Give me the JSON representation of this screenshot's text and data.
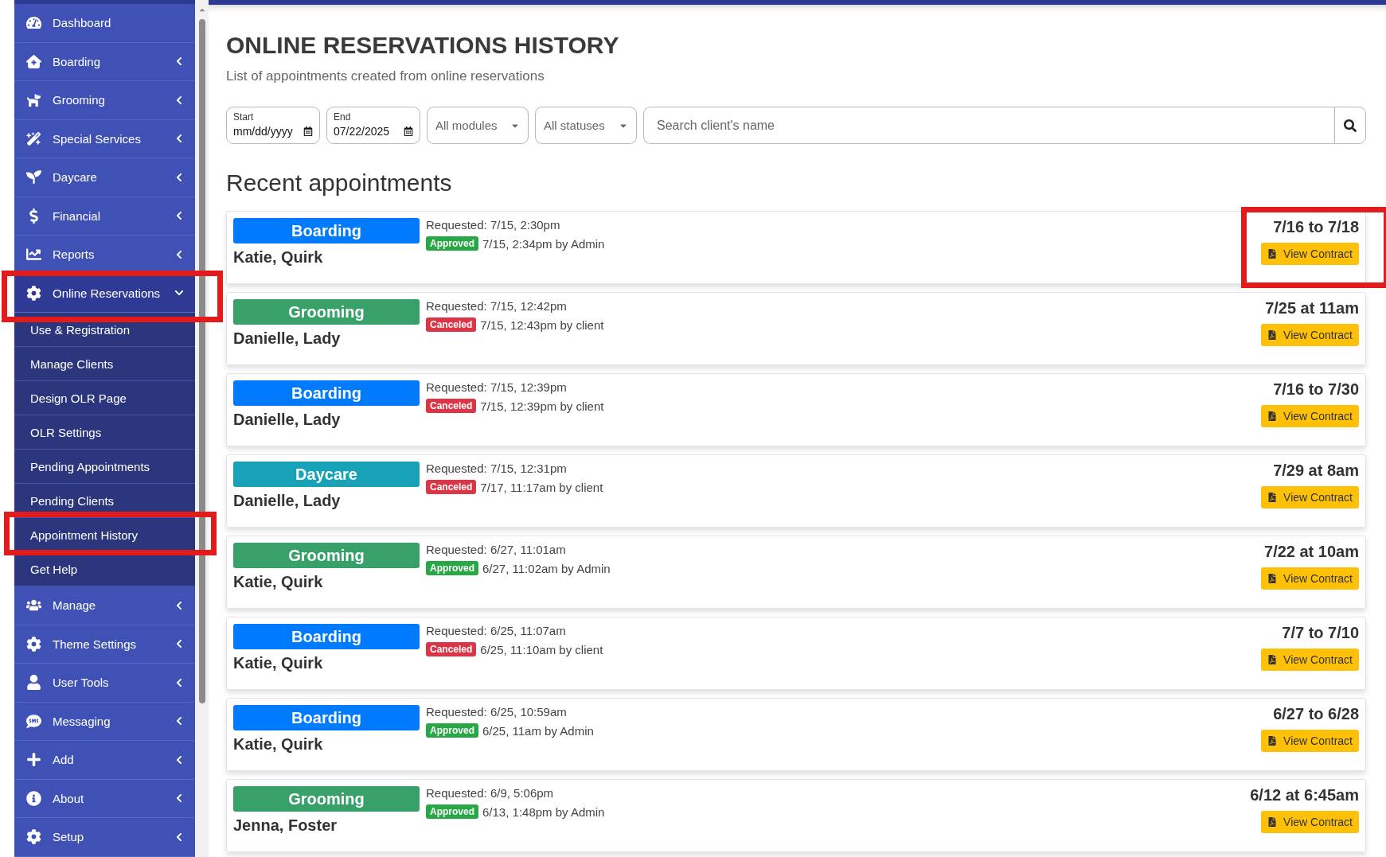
{
  "sidebar": {
    "items": [
      {
        "label": "Dashboard",
        "kind": "link",
        "expanded": false,
        "highlighted": false
      },
      {
        "label": "Boarding",
        "kind": "menu",
        "expanded": false,
        "highlighted": false
      },
      {
        "label": "Grooming",
        "kind": "menu",
        "expanded": false,
        "highlighted": false
      },
      {
        "label": "Special Services",
        "kind": "menu",
        "expanded": false,
        "highlighted": false
      },
      {
        "label": "Daycare",
        "kind": "menu",
        "expanded": false,
        "highlighted": false
      },
      {
        "label": "Financial",
        "kind": "menu",
        "expanded": false,
        "highlighted": false
      },
      {
        "label": "Reports",
        "kind": "menu",
        "expanded": false,
        "highlighted": false
      },
      {
        "label": "Online Reservations",
        "kind": "menu",
        "expanded": true,
        "highlighted": true,
        "children": [
          {
            "label": "Use & Registration",
            "highlighted": false
          },
          {
            "label": "Manage Clients",
            "highlighted": false
          },
          {
            "label": "Design OLR Page",
            "highlighted": false
          },
          {
            "label": "OLR Settings",
            "highlighted": false
          },
          {
            "label": "Pending Appointments",
            "highlighted": false
          },
          {
            "label": "Pending Clients",
            "highlighted": false
          },
          {
            "label": "Appointment History",
            "highlighted": true
          },
          {
            "label": "Get Help",
            "highlighted": false
          }
        ]
      },
      {
        "label": "Manage",
        "kind": "menu",
        "expanded": false,
        "highlighted": false
      },
      {
        "label": "Theme Settings",
        "kind": "menu",
        "expanded": false,
        "highlighted": false
      },
      {
        "label": "User Tools",
        "kind": "menu",
        "expanded": false,
        "highlighted": false
      },
      {
        "label": "Messaging",
        "kind": "menu",
        "expanded": false,
        "highlighted": false
      },
      {
        "label": "Add",
        "kind": "menu",
        "expanded": false,
        "highlighted": false
      },
      {
        "label": "About",
        "kind": "menu",
        "expanded": false,
        "highlighted": false
      },
      {
        "label": "Setup",
        "kind": "menu",
        "expanded": false,
        "highlighted": false
      }
    ]
  },
  "page": {
    "title": "ONLINE RESERVATIONS HISTORY",
    "subtitle": "List of appointments created from online reservations"
  },
  "filters": {
    "start": {
      "label": "Start",
      "placeholder": "mm/dd/yyyy"
    },
    "end": {
      "label": "End",
      "value": "07/22/2025"
    },
    "module": "All modules",
    "status": "All statuses",
    "search": {
      "placeholder": "Search client's name"
    }
  },
  "section_title": "Recent appointments",
  "appointments": [
    {
      "module": "Boarding",
      "color": "#007bff",
      "client": "Katie, Quirk",
      "requested": "Requested: 7/15, 2:30pm",
      "status": {
        "label": "Approved",
        "kind": "approved"
      },
      "status_detail": "7/15, 2:34pm by Admin",
      "date": "7/16 to 7/18",
      "button": "View Contract",
      "highlighted": true
    },
    {
      "module": "Grooming",
      "color": "#38a169",
      "client": "Danielle, Lady",
      "requested": "Requested: 7/15, 12:42pm",
      "status": {
        "label": "Canceled",
        "kind": "canceled"
      },
      "status_detail": "7/15, 12:43pm by client",
      "date": "7/25 at 11am",
      "button": "View Contract",
      "highlighted": false
    },
    {
      "module": "Boarding",
      "color": "#007bff",
      "client": "Danielle, Lady",
      "requested": "Requested: 7/15, 12:39pm",
      "status": {
        "label": "Canceled",
        "kind": "canceled"
      },
      "status_detail": "7/15, 12:39pm by client",
      "date": "7/16 to 7/30",
      "button": "View Contract",
      "highlighted": false
    },
    {
      "module": "Daycare",
      "color": "#17a2b8",
      "client": "Danielle, Lady",
      "requested": "Requested: 7/15, 12:31pm",
      "status": {
        "label": "Canceled",
        "kind": "canceled"
      },
      "status_detail": "7/17, 11:17am by client",
      "date": "7/29 at 8am",
      "button": "View Contract",
      "highlighted": false
    },
    {
      "module": "Grooming",
      "color": "#38a169",
      "client": "Katie, Quirk",
      "requested": "Requested: 6/27, 11:01am",
      "status": {
        "label": "Approved",
        "kind": "approved"
      },
      "status_detail": "6/27, 11:02am by Admin",
      "date": "7/22 at 10am",
      "button": "View Contract",
      "highlighted": false
    },
    {
      "module": "Boarding",
      "color": "#007bff",
      "client": "Katie, Quirk",
      "requested": "Requested: 6/25, 11:07am",
      "status": {
        "label": "Canceled",
        "kind": "canceled"
      },
      "status_detail": "6/25, 11:10am by client",
      "date": "7/7 to 7/10",
      "button": "View Contract",
      "highlighted": false
    },
    {
      "module": "Boarding",
      "color": "#007bff",
      "client": "Katie, Quirk",
      "requested": "Requested: 6/25, 10:59am",
      "status": {
        "label": "Approved",
        "kind": "approved"
      },
      "status_detail": "6/25, 11am by Admin",
      "date": "6/27 to 6/28",
      "button": "View Contract",
      "highlighted": false
    },
    {
      "module": "Grooming",
      "color": "#38a169",
      "client": "Jenna, Foster",
      "requested": "Requested: 6/9, 5:06pm",
      "status": {
        "label": "Approved",
        "kind": "approved"
      },
      "status_detail": "6/13, 1:48pm by Admin",
      "date": "6/12 at 6:45am",
      "button": "View Contract",
      "highlighted": false
    }
  ]
}
